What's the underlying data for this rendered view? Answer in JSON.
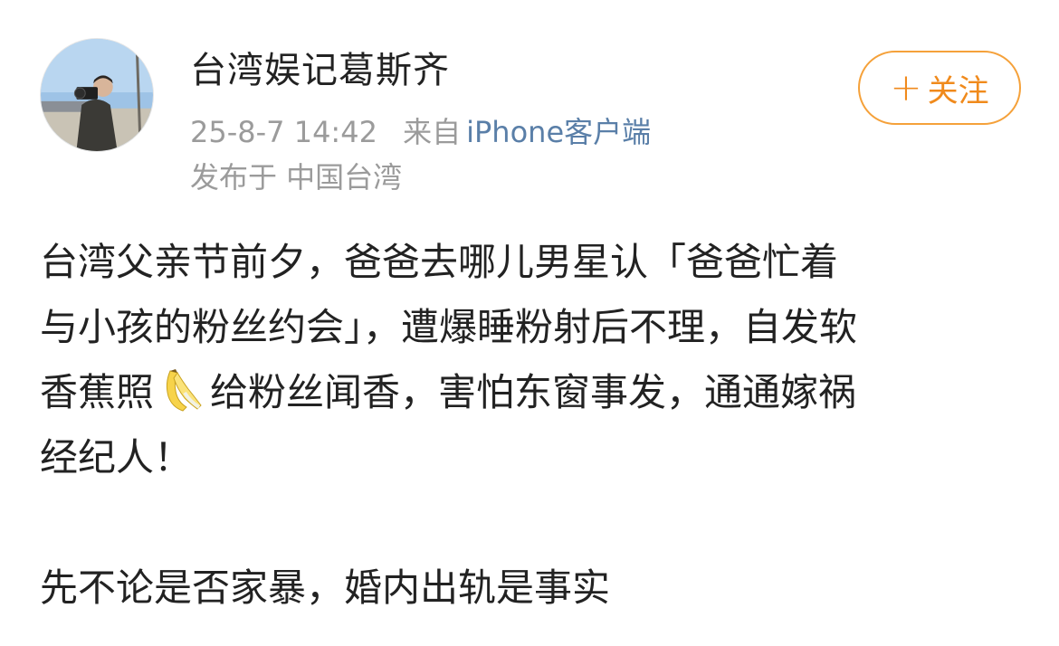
{
  "post": {
    "username": "台湾娱记葛斯齐",
    "timestamp": "25-8-7 14:42",
    "source_prefix": "来自",
    "source": "iPhone客户端",
    "location": "发布于 中国台湾",
    "follow_label": "关注",
    "follow_icon": "plus-icon",
    "avatar_icon": "photographer-avatar",
    "content": {
      "line1": "台湾父亲节前夕，爸爸去哪儿男星认「爸爸忙着",
      "line2": "与小孩的粉丝约会」，遭爆睡粉射后不理，自发软",
      "line3_before_emoji": "香蕉照",
      "emoji": "banana-emoji",
      "line3_after_emoji": "给粉丝闻香，害怕东窗事发，通通嫁祸",
      "line4": "经纪人！",
      "line5": "先不论是否家暴，婚内出轨是事实"
    },
    "colors": {
      "follow_accent": "#f08a1c",
      "meta_gray": "#9b9b9b",
      "source_blue": "#5a7fa8",
      "text": "#222222"
    }
  }
}
